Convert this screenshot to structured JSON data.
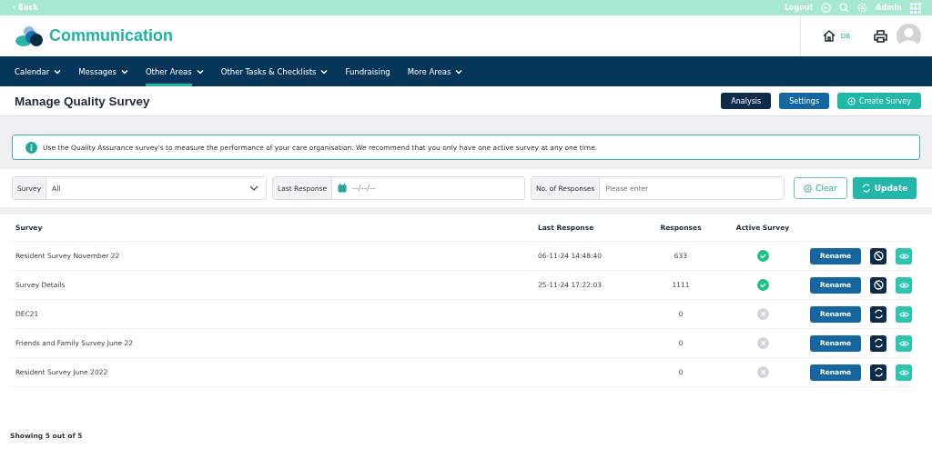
{
  "top_bar": {
    "back": "‹ Back",
    "logout": "Logout",
    "user": "Admin"
  },
  "header": {
    "title": "Communication",
    "home_label": "DB"
  },
  "nav": [
    {
      "label": "Calendar",
      "dropdown": true,
      "selected": false
    },
    {
      "label": "Messages",
      "dropdown": true,
      "selected": false
    },
    {
      "label": "Other Areas",
      "dropdown": true,
      "selected": true
    },
    {
      "label": "Other Tasks & Checklists",
      "dropdown": true,
      "selected": false
    },
    {
      "label": "Fundraising",
      "dropdown": false,
      "selected": false
    },
    {
      "label": "More Areas",
      "dropdown": true,
      "selected": false
    }
  ],
  "page": {
    "title": "Manage Quality Survey",
    "buttons": [
      {
        "label": "Analysis",
        "kind": "dark"
      },
      {
        "label": "Settings",
        "kind": "blue"
      },
      {
        "label": "Create Survey",
        "kind": "create"
      }
    ]
  },
  "info": "Use the Quality Assurance survey's to measure the performance of your care organisation. We recommend that you only have one active survey at any one time.",
  "filters": {
    "survey": {
      "label": "Survey",
      "value": "All"
    },
    "last_response": {
      "label": "Last Response",
      "value": "--/--/--"
    },
    "responses": {
      "label": "No. of Responses",
      "placeholder": "Please enter"
    },
    "clear": "Clear",
    "update": "Update"
  },
  "table": {
    "columns": [
      "Survey",
      "Last Response",
      "Responses",
      "Active Survey"
    ],
    "rows": [
      {
        "survey": "Resident Survey November 22",
        "last_response": "06-11-24 14:48:40",
        "responses": "633",
        "active": true,
        "action": "Rename"
      },
      {
        "survey": "Survey Details",
        "last_response": "25-11-24 17:22:03",
        "responses": "1111",
        "active": true,
        "action": "Rename"
      },
      {
        "survey": "DEC21",
        "responses": "0",
        "active": false,
        "action": "Rename"
      },
      {
        "survey": "Friends and Family Survey June 22",
        "responses": "0",
        "active": false,
        "action": "Rename"
      },
      {
        "survey": "Resident Survey June 2022",
        "responses": "0",
        "active": false,
        "action": "Rename"
      }
    ]
  },
  "footer": "Showing 5 out of 5"
}
